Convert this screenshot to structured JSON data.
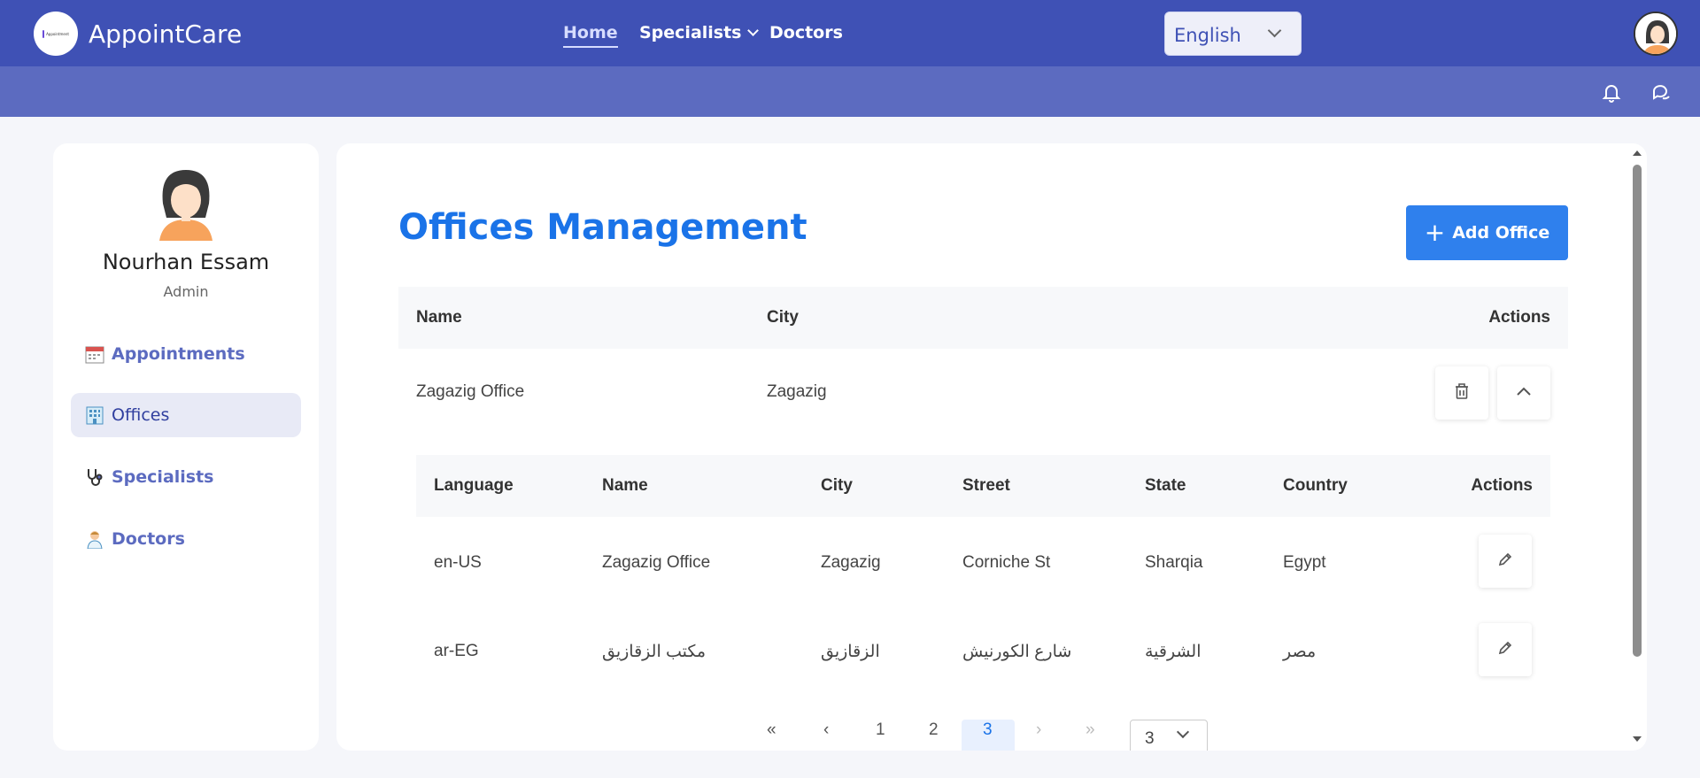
{
  "app": {
    "brand": "AppointCare",
    "logo_text": "Appointment",
    "nav": {
      "home": "Home",
      "specialists": "Specialists",
      "doctors": "Doctors"
    },
    "language": "English"
  },
  "sidebar": {
    "name": "Nourhan Essam",
    "role": "Admin",
    "items": [
      {
        "label": "Appointments",
        "icon": "calendar-icon"
      },
      {
        "label": "Offices",
        "icon": "building-icon"
      },
      {
        "label": "Specialists",
        "icon": "stethoscope-icon"
      },
      {
        "label": "Doctors",
        "icon": "doctor-icon"
      }
    ]
  },
  "main": {
    "title": "Offices Management",
    "add_button": "Add Office",
    "columns": {
      "name": "Name",
      "city": "City",
      "actions": "Actions"
    },
    "office": {
      "name": "Zagazig Office",
      "city": "Zagazig"
    },
    "sub_columns": {
      "language": "Language",
      "name": "Name",
      "city": "City",
      "street": "Street",
      "state": "State",
      "country": "Country",
      "actions": "Actions"
    },
    "translations": [
      {
        "language": "en-US",
        "name": "Zagazig Office",
        "city": "Zagazig",
        "street": "Corniche St",
        "state": "Sharqia",
        "country": "Egypt"
      },
      {
        "language": "ar-EG",
        "name": "مكتب الزقازيق",
        "city": "الزقازيق",
        "street": "شارع الكورنيش",
        "state": "الشرقية",
        "country": "مصر"
      }
    ],
    "pagination": {
      "first": "«",
      "prev": "‹",
      "pages": [
        "1",
        "2",
        "3"
      ],
      "current": "3",
      "next": "›",
      "last": "»",
      "page_size": "3"
    }
  },
  "colors": {
    "primary": "#3f51b5",
    "subbar": "#5c6bc0",
    "accent": "#2f80ed",
    "title": "#1a73e8"
  }
}
